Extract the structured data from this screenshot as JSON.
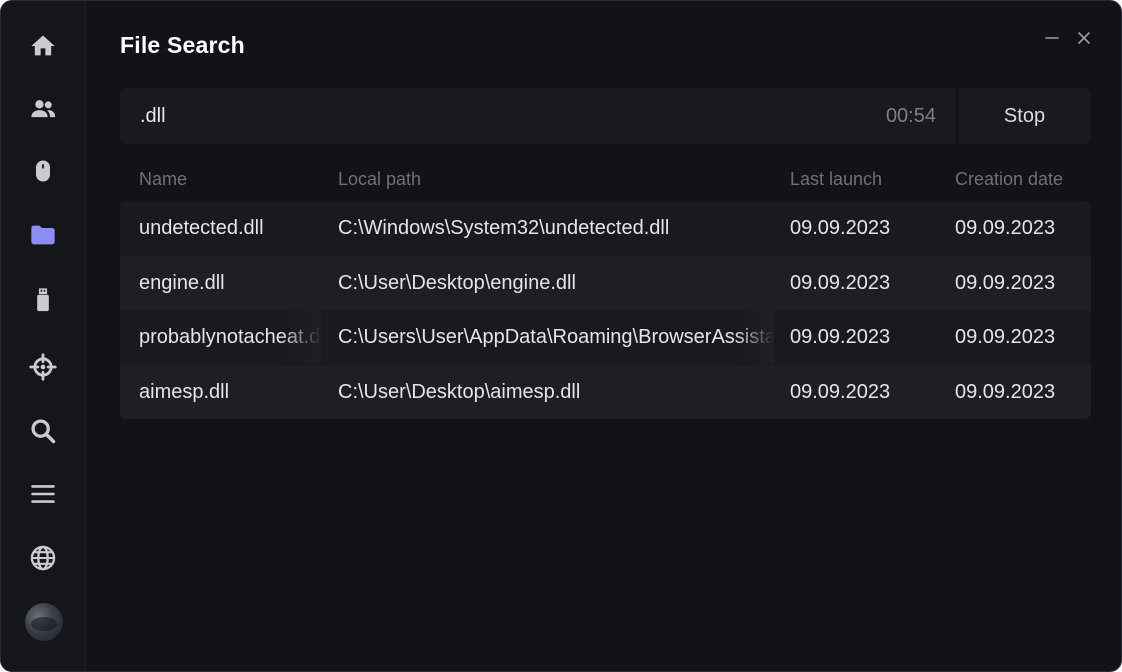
{
  "window": {
    "title": "File Search",
    "controls": {
      "minimize_icon": "minimize-icon",
      "close_icon": "close-icon"
    }
  },
  "sidebar": {
    "items": [
      {
        "id": "home",
        "icon": "home-icon",
        "active": false
      },
      {
        "id": "users",
        "icon": "users-icon",
        "active": false
      },
      {
        "id": "mouse",
        "icon": "mouse-icon",
        "active": false
      },
      {
        "id": "folder",
        "icon": "folder-icon",
        "active": true
      },
      {
        "id": "usb",
        "icon": "usb-drive-icon",
        "active": false
      },
      {
        "id": "crosshair",
        "icon": "crosshair-icon",
        "active": false
      },
      {
        "id": "search",
        "icon": "search-icon",
        "active": false
      },
      {
        "id": "list",
        "icon": "list-icon",
        "active": false
      },
      {
        "id": "globe",
        "icon": "globe-icon",
        "active": false
      }
    ],
    "avatar": "user-avatar"
  },
  "search": {
    "query": ".dll",
    "timer": "00:54",
    "stop_label": "Stop"
  },
  "table": {
    "columns": [
      "Name",
      "Local path",
      "Last launch",
      "Creation date"
    ],
    "rows": [
      {
        "name": "undetected.dll",
        "path": "C:\\Windows\\System32\\undetected.dll",
        "last_launch": "09.09.2023",
        "created": "09.09.2023"
      },
      {
        "name": "engine.dll",
        "path": "C:\\User\\Desktop\\engine.dll",
        "last_launch": "09.09.2023",
        "created": "09.09.2023"
      },
      {
        "name": "probablynotacheat.dll",
        "path": "C:\\Users\\User\\AppData\\Roaming\\BrowserAssistant\\probablynotacheat.dll",
        "last_launch": "09.09.2023",
        "created": "09.09.2023"
      },
      {
        "name": "aimesp.dll",
        "path": "C:\\User\\Desktop\\aimesp.dll",
        "last_launch": "09.09.2023",
        "created": "09.09.2023"
      }
    ]
  },
  "colors": {
    "background": "#121318",
    "sidebar": "#15161b",
    "accent": "#8c8cf5",
    "icon": "#c9cbd1",
    "text": "#e4e5e8",
    "muted": "#6f7178"
  }
}
